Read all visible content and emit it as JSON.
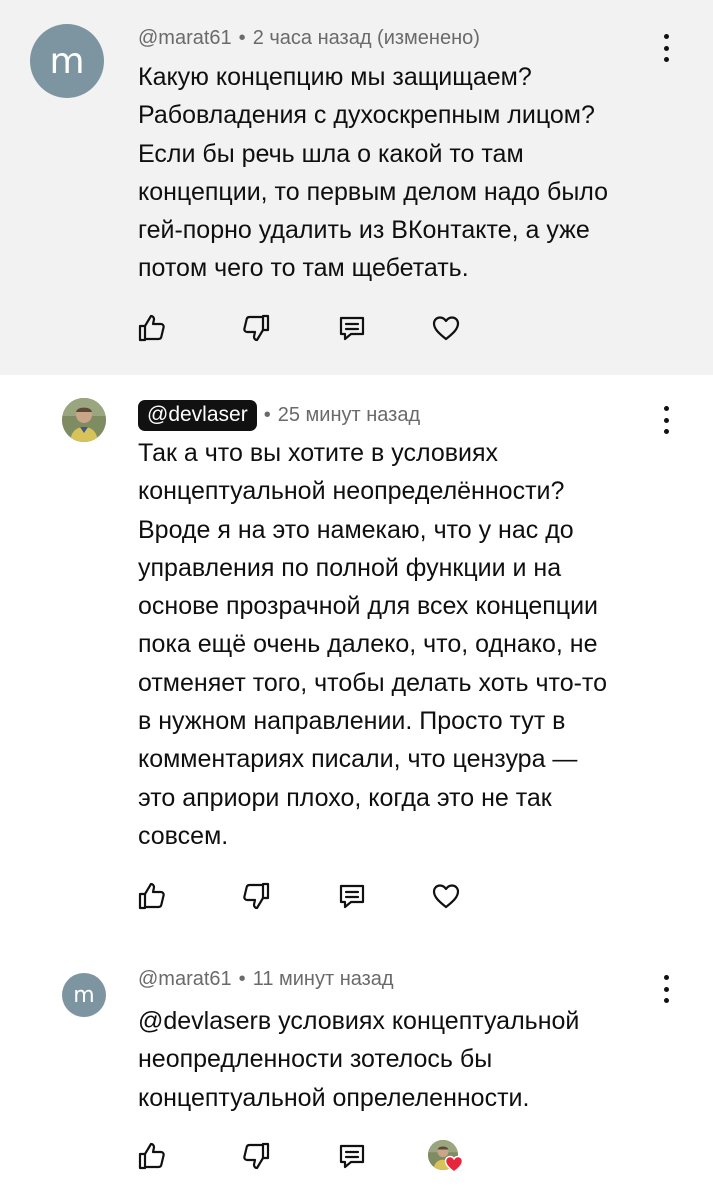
{
  "comments": [
    {
      "author": "@marat61",
      "avatar_letter": "m",
      "time": "2 часа назад (изменено)",
      "text": "Какую концепцию мы защищаем?\nРабовладения с духоскрепным лицом?\nЕсли бы речь шла о какой то там\nконцепции, то первым делом надо было\nгей-порно удалить из ВКонтакте, а уже\nпотом чего то там щебетать.",
      "liked_by_author": false
    },
    {
      "author": "@devlaser",
      "author_is_channel_owner": true,
      "time": "25 минут назад",
      "text": "Так а что вы хотите в условиях\nконцептуальной неопределённости?\nВроде я на это намекаю, что у нас до\nуправления по полной функции и на\nоснове прозрачной для всех концепции\nпока ещё очень далеко, что, однако, не\nотменяет того, чтобы делать хоть что-то\nв нужном направлении. Просто тут в\nкомментариях писали, что цензура —\nэто априори плохо, когда это не так\nсовсем.",
      "liked_by_author": false
    },
    {
      "author": "@marat61",
      "avatar_letter": "m",
      "time": "11 минут назад",
      "text": "@devlaserв условиях концептуальной\nнеопредленности зотелось бы\nконцептуальной опрелеленности.",
      "liked_by_author": true
    }
  ],
  "separator": "•",
  "colors": {
    "highlight_bg": "#f2f2f2",
    "avatar_bg": "#7d95a1",
    "meta_text": "#6a6a6a",
    "heart_red": "#e8253b"
  }
}
